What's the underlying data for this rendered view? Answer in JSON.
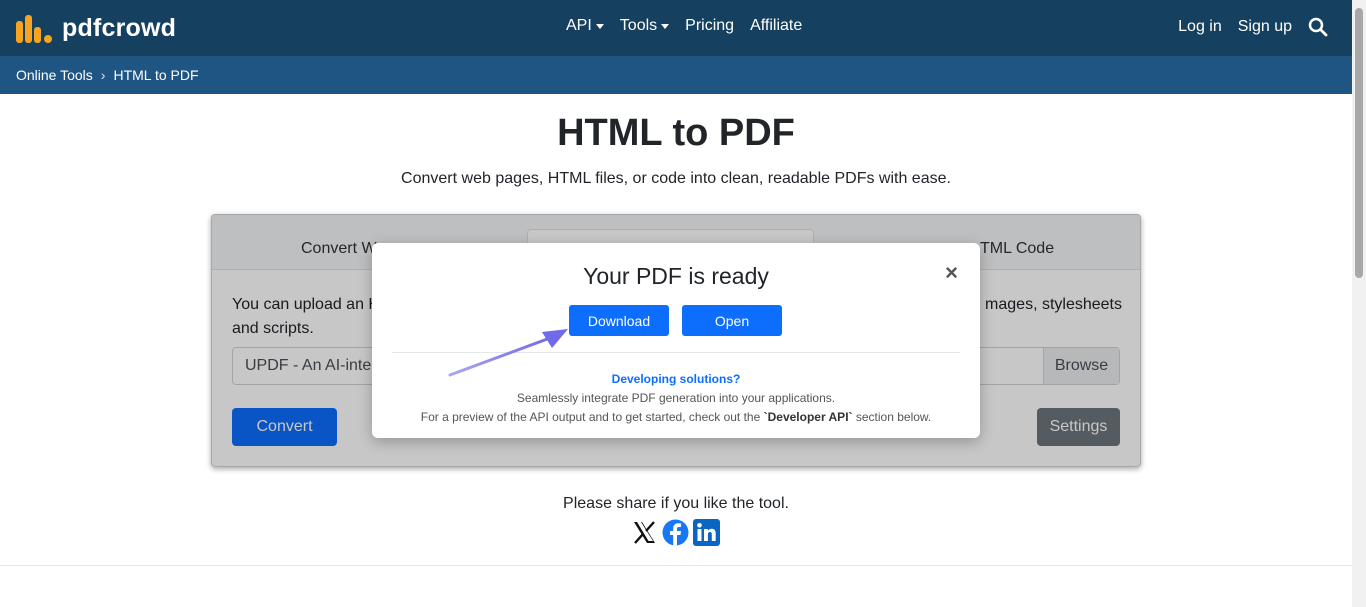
{
  "header": {
    "logo_text": "pdfcrowd",
    "nav": [
      {
        "label": "API",
        "dropdown": true
      },
      {
        "label": "Tools",
        "dropdown": true
      },
      {
        "label": "Pricing",
        "dropdown": false
      },
      {
        "label": "Affiliate",
        "dropdown": false
      }
    ],
    "login": "Log in",
    "signup": "Sign up",
    "brand_color": "#16405f",
    "accent_color": "#f7a420"
  },
  "breadcrumb": {
    "items": [
      "Online Tools",
      "HTML to PDF"
    ],
    "separator": "›"
  },
  "page": {
    "title": "HTML to PDF",
    "subtitle": "Convert web pages, HTML files, or code into clean, readable PDFs with ease."
  },
  "converter": {
    "tabs": [
      "Convert W",
      "TML Code"
    ],
    "description": "You can upload an H                                                                                                                                          mages, stylesheets and scripts.",
    "desc_left": "You can upload an H",
    "desc_right": "mages, stylesheets",
    "desc_line2": "and scripts.",
    "file_value": "UPDF - An AI-inte",
    "browse_label": "Browse",
    "convert_label": "Convert",
    "settings_label": "Settings"
  },
  "share": {
    "text": "Please share if you like the tool.",
    "icons": [
      "x-icon",
      "facebook-icon",
      "linkedin-icon"
    ]
  },
  "modal": {
    "title": "Your PDF is ready",
    "close": "×",
    "download_label": "Download",
    "open_label": "Open",
    "dev_title": "Developing solutions?",
    "dev_line1": "Seamlessly integrate PDF generation into your applications.",
    "dev_line2_pre": "For a preview of the API output and to get started, check out the ",
    "dev_line2_bold": "`Developer API`",
    "dev_line2_post": " section below."
  }
}
